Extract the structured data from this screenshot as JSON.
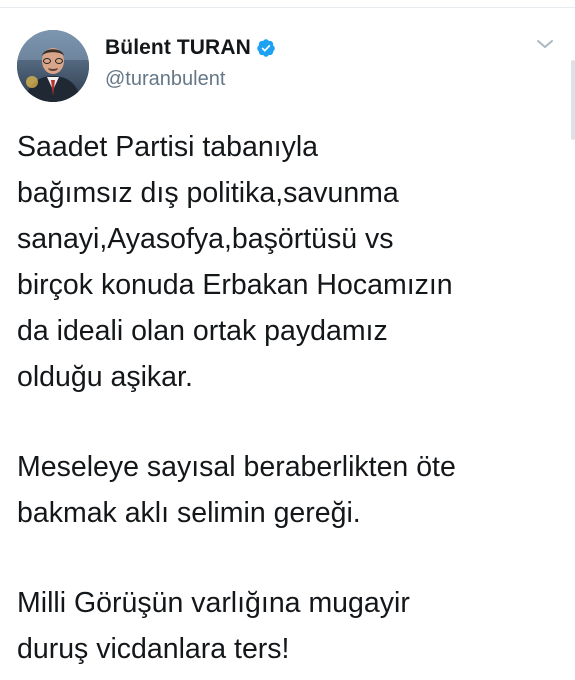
{
  "author": {
    "display_name": "Bülent TURAN",
    "handle": "@turanbulent",
    "verified": true,
    "verified_icon": "verified-badge-icon",
    "avatar_icon": "profile-avatar"
  },
  "menu": {
    "icon": "chevron-down-icon"
  },
  "colors": {
    "verified_blue": "#1da1f2",
    "text": "#14171a",
    "secondary": "#657786",
    "divider": "#e6ecf0"
  },
  "tweet": {
    "paragraphs": [
      {
        "lines": [
          "Saadet Partisi tabanıyla",
          "bağımsız dış politika,savunma",
          "sanayi,Ayasofya,başörtüsü vs",
          "birçok konuda Erbakan Hocamızın",
          "da ideali olan ortak paydamız",
          "olduğu aşikar."
        ]
      },
      {
        "lines": [
          "Meseleye sayısal beraberlikten öte",
          "bakmak aklı selimin gereği."
        ]
      },
      {
        "lines": [
          "Milli Görüşün varlığına mugayir",
          "duruş vicdanlara ters!"
        ]
      }
    ]
  }
}
